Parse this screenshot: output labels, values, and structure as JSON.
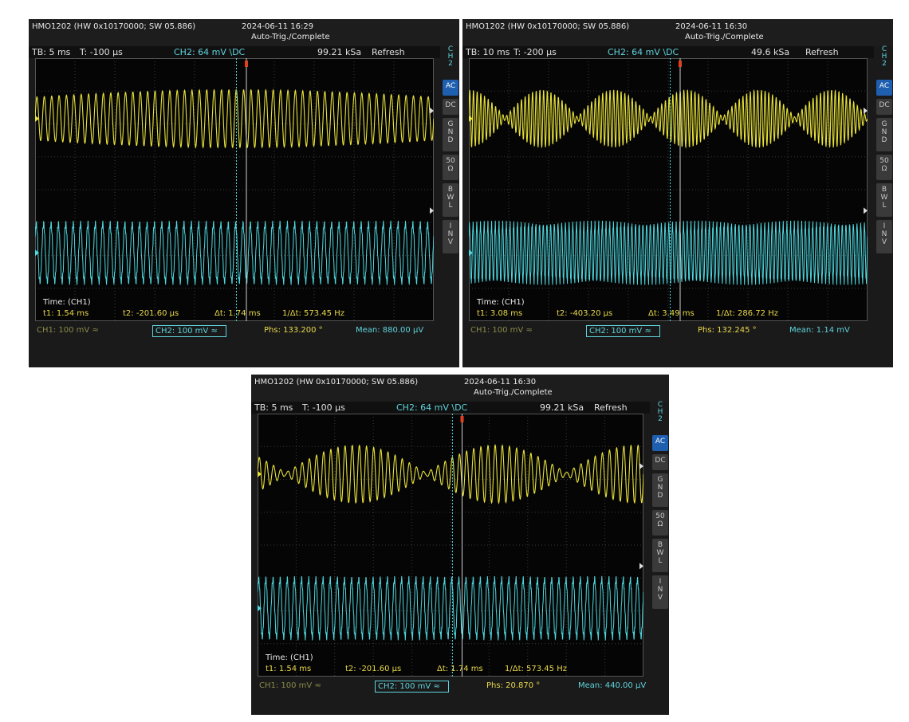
{
  "screens": [
    {
      "model": "HMO1202 (HW 0x10170000; SW 05.886)",
      "datetime": "2024-06-11 16:29",
      "status": "Auto-Trig./Complete",
      "timebase": "TB: 5 ms",
      "trigger_time": "T: -100 µs",
      "trigger_source": "CH2: 64 mV \\DC",
      "sample_rate": "99.21 kSa",
      "mode": "Refresh",
      "time_label": "Time: (CH1)",
      "t1": "t1: 1.54 ms",
      "t2": "t2: -201.60 µs",
      "dt": "Δt: 1.74 ms",
      "inv_dt": "1/Δt: 573.45 Hz",
      "ch1_scale": "CH1: 100 mV ≈",
      "ch2_scale": "CH2: 100 mV ≈",
      "phase": "Phs: 133.200 °",
      "mean": "Mean: 880.00 µV",
      "envelope_cycles": 1,
      "carrier_cycles": 54,
      "ch1_mod_depth": 0.25,
      "ch1_phase_offset": 0.5
    },
    {
      "model": "HMO1202 (HW 0x10170000; SW 05.886)",
      "datetime": "2024-06-11 16:30",
      "status": "Auto-Trig./Complete",
      "timebase": "TB: 10 ms",
      "trigger_time": "T: -200 µs",
      "trigger_source": "CH2: 64 mV \\DC",
      "sample_rate": "49.6 kSa",
      "mode": "Refresh",
      "time_label": "Time: (CH1)",
      "t1": "t1: 3.08 ms",
      "t2": "t2: -403.20 µs",
      "dt": "Δt: 3.49 ms",
      "inv_dt": "1/Δt: 286.72 Hz",
      "ch1_scale": "CH1: 100 mV ≈",
      "ch2_scale": "CH2: 100 mV ≈",
      "phase": "Phs: 132.245 °",
      "mean": "Mean: 1.14 mV",
      "envelope_cycles": 5.5,
      "carrier_cycles": 108,
      "ch1_mod_depth": 0.95,
      "ch1_phase_offset": 0.0
    },
    {
      "model": "HMO1202 (HW 0x10170000; SW 05.886)",
      "datetime": "2024-06-11 16:30",
      "status": "Auto-Trig./Complete",
      "timebase": "TB: 5 ms",
      "trigger_time": "T: -100 µs",
      "trigger_source": "CH2: 64 mV \\DC",
      "sample_rate": "99.21 kSa",
      "mode": "Refresh",
      "time_label": "Time: (CH1)",
      "t1": "t1: 1.54 ms",
      "t2": "t2: -201.60 µs",
      "dt": "Δt: 1.74 ms",
      "inv_dt": "1/Δt: 573.45 Hz",
      "ch1_scale": "CH1: 100 mV ≈",
      "ch2_scale": "CH2: 100 mV ≈",
      "phase": "Phs: 20.870 °",
      "mean": "Mean: 440.00 µV",
      "envelope_cycles": 2.75,
      "carrier_cycles": 54,
      "ch1_mod_depth": 0.95,
      "ch1_phase_offset": 0.3
    }
  ],
  "side_panel": {
    "channel_label": [
      "C",
      "H",
      "2"
    ],
    "buttons": [
      {
        "label": "AC",
        "active": true
      },
      {
        "label": "DC",
        "active": false
      },
      {
        "label": "G\nN\nD",
        "active": false
      },
      {
        "label": "50\nΩ",
        "active": false
      },
      {
        "label": "B\nW\nL",
        "active": false
      },
      {
        "label": "I\nN\nV",
        "active": false
      }
    ]
  },
  "colors": {
    "ch1": "#e8e23a",
    "ch2": "#4fd8e0",
    "grid": "#3a3a3a",
    "cursor1": "#cfcfcf",
    "cursor2": "#4fd8e0",
    "trigger_marker": "#e04020"
  }
}
